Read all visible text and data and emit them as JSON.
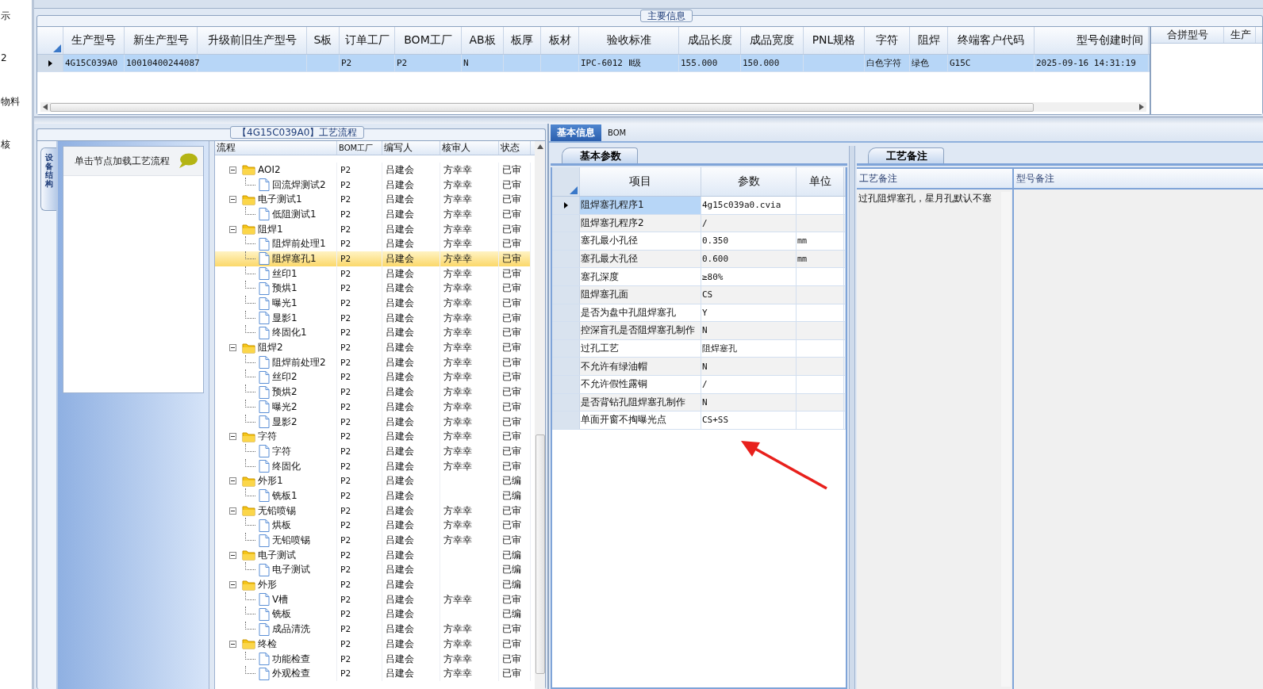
{
  "left_nav": [
    "示",
    "2",
    "物料",
    "核"
  ],
  "main_info": {
    "title": "主要信息",
    "columns": [
      "生产型号",
      "新生产型号",
      "升级前旧生产型号",
      "S板",
      "订单工厂",
      "BOM工厂",
      "AB板",
      "板厚",
      "板材",
      "验收标准",
      "成品长度",
      "成品宽度",
      "PNL规格",
      "字符",
      "阻焊",
      "终端客户代码",
      "型号创建时间"
    ],
    "rows": [
      {
        "selected": true,
        "cells": [
          "4G15C039A0",
          "10010400244087",
          null,
          null,
          "P2",
          "P2",
          "N",
          null,
          null,
          "IPC-6012 Ⅱ级",
          "155.000",
          "150.000",
          null,
          "白色字符",
          "绿色",
          "G15C",
          "2025-09-16 14:31:19"
        ]
      }
    ],
    "side_columns": [
      "合拼型号",
      "生产"
    ]
  },
  "process": {
    "title": "【4G15C039A0】工艺流程",
    "side_tab": "设备结构",
    "hint": "单击节点加载工艺流程",
    "columns": [
      "流程",
      "BOM工厂",
      "编写人",
      "核审人",
      "状态"
    ],
    "tree": [
      {
        "label": "AOI2",
        "factory": "P2",
        "writer": "吕建会",
        "reviewer": "方幸幸",
        "status": "已审",
        "selected": false,
        "expanded": true,
        "children": [
          {
            "label": "回流焊测试2",
            "factory": "P2",
            "writer": "吕建会",
            "reviewer": "方幸幸",
            "status": "已审",
            "selected": false
          }
        ]
      },
      {
        "label": "电子测试1",
        "factory": "P2",
        "writer": "吕建会",
        "reviewer": "方幸幸",
        "status": "已审",
        "selected": false,
        "expanded": true,
        "children": [
          {
            "label": "低阻测试1",
            "factory": "P2",
            "writer": "吕建会",
            "reviewer": "方幸幸",
            "status": "已审",
            "selected": false
          }
        ]
      },
      {
        "label": "阻焊1",
        "factory": "P2",
        "writer": "吕建会",
        "reviewer": "方幸幸",
        "status": "已审",
        "selected": false,
        "expanded": true,
        "children": [
          {
            "label": "阻焊前处理1",
            "factory": "P2",
            "writer": "吕建会",
            "reviewer": "方幸幸",
            "status": "已审",
            "selected": false
          },
          {
            "label": "阻焊塞孔1",
            "factory": "P2",
            "writer": "吕建会",
            "reviewer": "方幸幸",
            "status": "已审",
            "selected": true
          },
          {
            "label": "丝印1",
            "factory": "P2",
            "writer": "吕建会",
            "reviewer": "方幸幸",
            "status": "已审",
            "selected": false
          },
          {
            "label": "预烘1",
            "factory": "P2",
            "writer": "吕建会",
            "reviewer": "方幸幸",
            "status": "已审",
            "selected": false
          },
          {
            "label": "曝光1",
            "factory": "P2",
            "writer": "吕建会",
            "reviewer": "方幸幸",
            "status": "已审",
            "selected": false
          },
          {
            "label": "显影1",
            "factory": "P2",
            "writer": "吕建会",
            "reviewer": "方幸幸",
            "status": "已审",
            "selected": false
          },
          {
            "label": "终固化1",
            "factory": "P2",
            "writer": "吕建会",
            "reviewer": "方幸幸",
            "status": "已审",
            "selected": false
          }
        ]
      },
      {
        "label": "阻焊2",
        "factory": "P2",
        "writer": "吕建会",
        "reviewer": "方幸幸",
        "status": "已审",
        "selected": false,
        "expanded": true,
        "children": [
          {
            "label": "阻焊前处理2",
            "factory": "P2",
            "writer": "吕建会",
            "reviewer": "方幸幸",
            "status": "已审",
            "selected": false
          },
          {
            "label": "丝印2",
            "factory": "P2",
            "writer": "吕建会",
            "reviewer": "方幸幸",
            "status": "已审",
            "selected": false
          },
          {
            "label": "预烘2",
            "factory": "P2",
            "writer": "吕建会",
            "reviewer": "方幸幸",
            "status": "已审",
            "selected": false
          },
          {
            "label": "曝光2",
            "factory": "P2",
            "writer": "吕建会",
            "reviewer": "方幸幸",
            "status": "已审",
            "selected": false
          },
          {
            "label": "显影2",
            "factory": "P2",
            "writer": "吕建会",
            "reviewer": "方幸幸",
            "status": "已审",
            "selected": false
          }
        ]
      },
      {
        "label": "字符",
        "factory": "P2",
        "writer": "吕建会",
        "reviewer": "方幸幸",
        "status": "已审",
        "selected": false,
        "expanded": true,
        "children": [
          {
            "label": "字符",
            "factory": "P2",
            "writer": "吕建会",
            "reviewer": "方幸幸",
            "status": "已审",
            "selected": false
          },
          {
            "label": "终固化",
            "factory": "P2",
            "writer": "吕建会",
            "reviewer": "方幸幸",
            "status": "已审",
            "selected": false
          }
        ]
      },
      {
        "label": "外形1",
        "factory": "P2",
        "writer": "吕建会",
        "status": "已编",
        "selected": false,
        "expanded": true,
        "children": [
          {
            "label": "铣板1",
            "factory": "P2",
            "writer": "吕建会",
            "status": "已编",
            "selected": false
          }
        ]
      },
      {
        "label": "无铅喷锡",
        "factory": "P2",
        "writer": "吕建会",
        "reviewer": "方幸幸",
        "status": "已审",
        "selected": false,
        "expanded": true,
        "children": [
          {
            "label": "烘板",
            "factory": "P2",
            "writer": "吕建会",
            "reviewer": "方幸幸",
            "status": "已审",
            "selected": false
          },
          {
            "label": "无铅喷锡",
            "factory": "P2",
            "writer": "吕建会",
            "reviewer": "方幸幸",
            "status": "已审",
            "selected": false
          }
        ]
      },
      {
        "label": "电子测试",
        "factory": "P2",
        "writer": "吕建会",
        "status": "已编",
        "selected": false,
        "expanded": true,
        "children": [
          {
            "label": "电子测试",
            "factory": "P2",
            "writer": "吕建会",
            "status": "已编",
            "selected": false
          }
        ]
      },
      {
        "label": "外形",
        "factory": "P2",
        "writer": "吕建会",
        "status": "已编",
        "selected": false,
        "expanded": true,
        "children": [
          {
            "label": "V槽",
            "factory": "P2",
            "writer": "吕建会",
            "reviewer": "方幸幸",
            "status": "已审",
            "selected": false
          },
          {
            "label": "铣板",
            "factory": "P2",
            "writer": "吕建会",
            "status": "已编",
            "selected": false
          },
          {
            "label": "成品清洗",
            "factory": "P2",
            "writer": "吕建会",
            "reviewer": "方幸幸",
            "status": "已审",
            "selected": false
          }
        ]
      },
      {
        "label": "终检",
        "factory": "P2",
        "writer": "吕建会",
        "reviewer": "方幸幸",
        "status": "已审",
        "selected": false,
        "expanded": true,
        "children": [
          {
            "label": "功能检查",
            "factory": "P2",
            "writer": "吕建会",
            "reviewer": "方幸幸",
            "status": "已审",
            "selected": false
          },
          {
            "label": "外观检查",
            "factory": "P2",
            "writer": "吕建会",
            "reviewer": "方幸幸",
            "status": "已审",
            "selected": false
          }
        ]
      }
    ]
  },
  "detail": {
    "tabs": [
      {
        "label": "基本信息",
        "selected": true
      },
      {
        "label": "BOM",
        "selected": false
      }
    ],
    "params": {
      "tab": "基本参数",
      "columns": [
        "项目",
        "参数",
        "单位"
      ],
      "rows": [
        {
          "item": "阻焊塞孔程序1",
          "value": "4g15c039a0.cvia",
          "selected": true
        },
        {
          "item": "阻焊塞孔程序2",
          "value": "/",
          "selected": false
        },
        {
          "item": "塞孔最小孔径",
          "value": "0.350",
          "unit": "mm",
          "selected": false
        },
        {
          "item": "塞孔最大孔径",
          "value": "0.600",
          "unit": "mm",
          "selected": false
        },
        {
          "item": "塞孔深度",
          "value": "≥80%",
          "selected": false
        },
        {
          "item": "阻焊塞孔面",
          "value": "CS",
          "selected": false
        },
        {
          "item": "是否为盘中孔阻焊塞孔",
          "value": "Y",
          "selected": false
        },
        {
          "item": "控深盲孔是否阻焊塞孔制作",
          "value": "N",
          "selected": false
        },
        {
          "item": "过孔工艺",
          "value": "阻焊塞孔",
          "selected": false
        },
        {
          "item": "不允许有绿油帽",
          "value": "N",
          "selected": false
        },
        {
          "item": "不允许假性露铜",
          "value": "/",
          "selected": false
        },
        {
          "item": "是否背钻孔阻焊塞孔制作",
          "value": "N",
          "selected": false
        },
        {
          "item": "单面开窗不掏曝光点",
          "value": "CS+SS",
          "selected": false
        }
      ]
    },
    "notes": {
      "tab": "工艺备注",
      "columns": [
        "工艺备注",
        "型号备注"
      ],
      "process_note": "过孔阻焊塞孔，星月孔默认不塞"
    }
  }
}
